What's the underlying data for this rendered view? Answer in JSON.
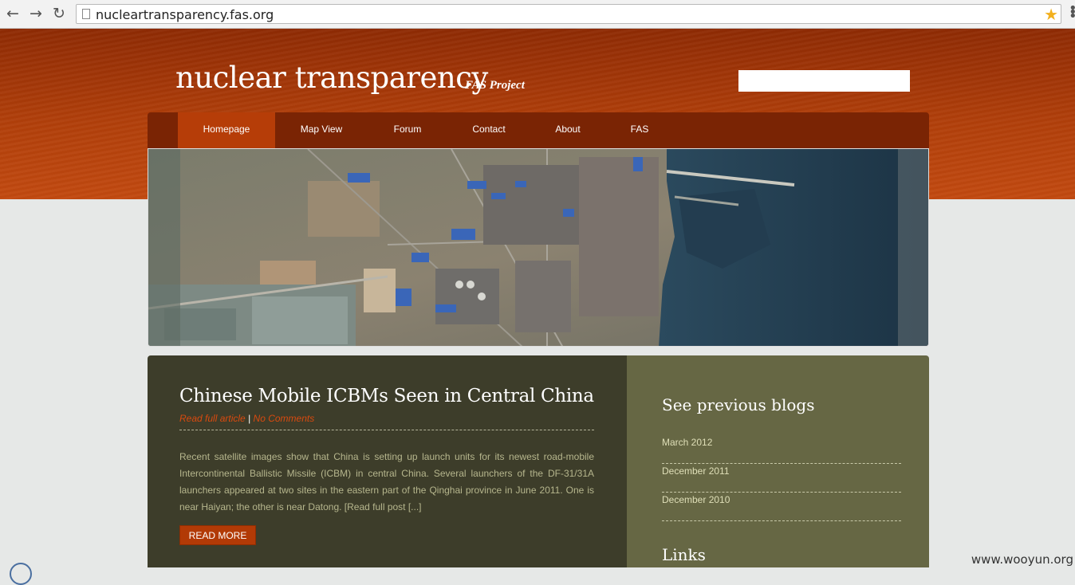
{
  "browser": {
    "url": "nucleartransparency.fas.org",
    "icons": [
      "back-arrow-icon",
      "forward-arrow-icon",
      "reload-icon",
      "page-icon",
      "bookmark-star-icon",
      "menu-icon"
    ]
  },
  "header": {
    "title": "nuclear transparency",
    "subtitle": "FAS Project",
    "search_placeholder": ""
  },
  "nav": {
    "items": [
      {
        "label": "Homepage",
        "active": true
      },
      {
        "label": "Map View",
        "active": false
      },
      {
        "label": "Forum",
        "active": false
      },
      {
        "label": "Contact",
        "active": false
      },
      {
        "label": "About",
        "active": false
      },
      {
        "label": "FAS",
        "active": false
      }
    ]
  },
  "post": {
    "title": "Chinese Mobile ICBMs Seen in Central China",
    "read_full": "Read full article",
    "separator": "|",
    "comments": "No Comments",
    "body": "Recent satellite images show that China is setting up launch units for its newest road-mobile Intercontinental Ballistic Missile (ICBM) in central China. Several launchers of the DF-31/31A launchers appeared at two sites in the eastern part of the Qinghai province in June 2011. One is near Haiyan; the other is near Datong. [Read full post [...]",
    "read_more": "READ MORE"
  },
  "sidebar": {
    "blogs_heading": "See previous blogs",
    "blogs": [
      "March 2012",
      "December 2011",
      "December 2010"
    ],
    "links_heading": "Links"
  },
  "watermark": "www.wooyun.org",
  "colors": {
    "header_dark": "#8f2b04",
    "header_light": "#c24910",
    "nav_bg": "#7a2404",
    "nav_active": "#b63d08",
    "main_panel": "#3d3d2a",
    "side_panel": "#666744",
    "accent_link": "#d84a0f"
  }
}
